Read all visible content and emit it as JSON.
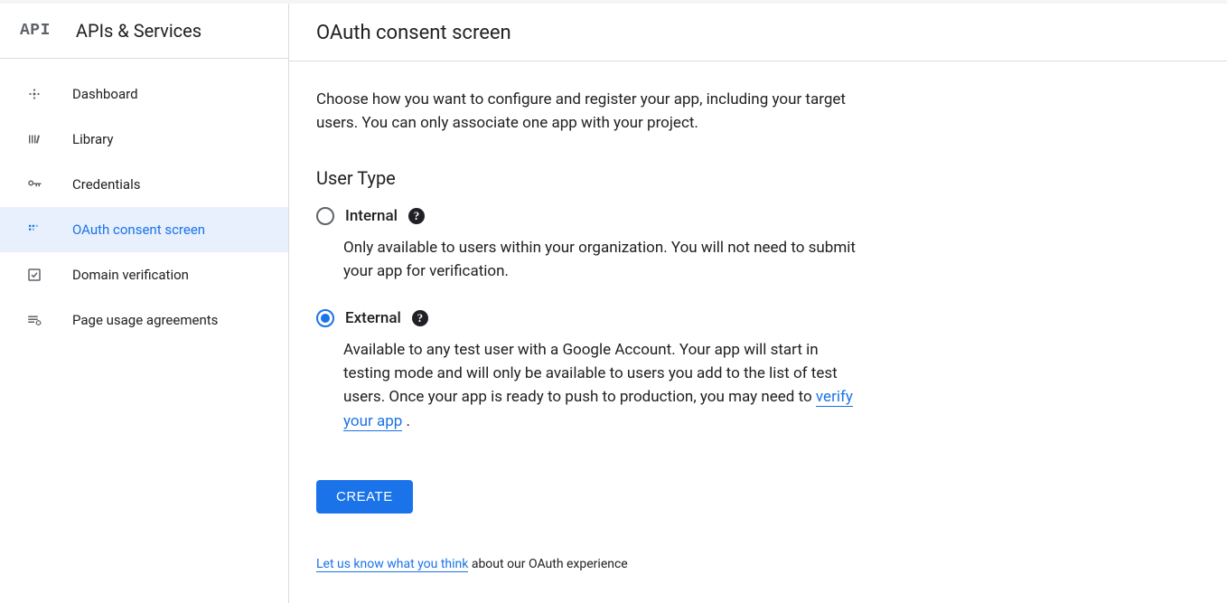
{
  "sidebar": {
    "logo_text": "API",
    "title": "APIs & Services",
    "items": [
      {
        "label": "Dashboard"
      },
      {
        "label": "Library"
      },
      {
        "label": "Credentials"
      },
      {
        "label": "OAuth consent screen"
      },
      {
        "label": "Domain verification"
      },
      {
        "label": "Page usage agreements"
      }
    ]
  },
  "main": {
    "title": "OAuth consent screen",
    "intro": "Choose how you want to configure and register your app, including your target users. You can only associate one app with your project.",
    "user_type_heading": "User Type",
    "options": {
      "internal": {
        "label": "Internal",
        "description": "Only available to users within your organization. You will not need to submit your app for verification."
      },
      "external": {
        "label": "External",
        "description_part1": "Available to any test user with a Google Account. Your app will start in testing mode and will only be available to users you add to the list of test users. Once your app is ready to push to production, you may need to ",
        "link": "verify your app",
        "description_part2": " ."
      }
    },
    "create_button": "CREATE",
    "feedback_link": "Let us know what you think",
    "feedback_text": " about our OAuth experience"
  }
}
